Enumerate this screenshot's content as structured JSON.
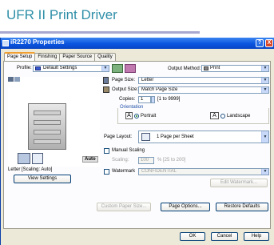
{
  "banner": {
    "title": "UFR II Print Driver"
  },
  "window": {
    "title": "iR2270 Properties",
    "help_glyph": "?",
    "close_glyph": "X"
  },
  "tabs": [
    {
      "label": "Page Setup"
    },
    {
      "label": "Finishing"
    },
    {
      "label": "Paper Source"
    },
    {
      "label": "Quality"
    }
  ],
  "profile": {
    "label": "Profile:",
    "value": "Default Settings"
  },
  "output_method": {
    "label": "Output Method:",
    "value": "Print"
  },
  "page_size": {
    "label": "Page Size:",
    "value": "Letter"
  },
  "output_size": {
    "label": "Output Size:",
    "value": "Match Page Size"
  },
  "copies": {
    "label": "Copies:",
    "value": "1",
    "range": "[1 to 9999]"
  },
  "orientation": {
    "label": "Orientation",
    "portrait": "Portrait",
    "landscape": "Landscape",
    "portrait_icon": "A",
    "landscape_icon": "A"
  },
  "page_layout": {
    "label": "Page Layout:",
    "value": "1 Page per Sheet"
  },
  "manual_scaling": {
    "label": "Manual Scaling"
  },
  "scaling": {
    "label": "Scaling:",
    "value": "100",
    "range": "% [25 to 200]"
  },
  "watermark": {
    "label": "Watermark",
    "value": "CONFIDENTIAL",
    "edit_button": "Edit Watermark..."
  },
  "preview": {
    "auto_badge": "Auto",
    "caption": "Letter [Scaling: Auto]",
    "view_settings_button": "View Settings"
  },
  "buttons": {
    "custom_paper_size": "Custom Paper Size...",
    "page_options": "Page Options...",
    "restore_defaults": "Restore Defaults",
    "ok": "OK",
    "cancel": "Cancel",
    "help": "Help"
  },
  "colors": {
    "banner_title": "#2f8fa8",
    "titlebar": "#0a55e0",
    "dialog_bg": "#ece9d8"
  }
}
